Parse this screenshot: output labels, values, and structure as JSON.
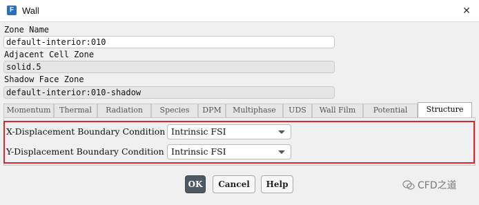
{
  "window": {
    "icon_letter": "F",
    "title": "Wall",
    "close_glyph": "✕"
  },
  "zone_name": {
    "label": "Zone Name",
    "value": "default-interior:010"
  },
  "adjacent_cell_zone": {
    "label": "Adjacent Cell Zone",
    "value": "solid.5"
  },
  "shadow_face_zone": {
    "label": "Shadow Face Zone",
    "value": "default-interior:010-shadow"
  },
  "tabs": [
    {
      "label": "Momentum",
      "active": false
    },
    {
      "label": "Thermal",
      "active": false
    },
    {
      "label": "Radiation",
      "active": false
    },
    {
      "label": "Species",
      "active": false
    },
    {
      "label": "DPM",
      "active": false
    },
    {
      "label": "Multiphase",
      "active": false
    },
    {
      "label": "UDS",
      "active": false
    },
    {
      "label": "Wall Film",
      "active": false
    },
    {
      "label": "Potential",
      "active": false
    },
    {
      "label": "Structure",
      "active": true
    }
  ],
  "structure": {
    "x_displacement": {
      "label": "X-Displacement Boundary Condition",
      "value": "Intrinsic FSI"
    },
    "y_displacement": {
      "label": "Y-Displacement Boundary Condition",
      "value": "Intrinsic FSI"
    }
  },
  "buttons": {
    "ok": "OK",
    "cancel": "Cancel",
    "help": "Help"
  },
  "watermark": {
    "text": "CFD之道"
  },
  "colors": {
    "highlight": "#d9262b",
    "ok_button": "#4e5a63",
    "app_icon": "#2a6ebd"
  }
}
